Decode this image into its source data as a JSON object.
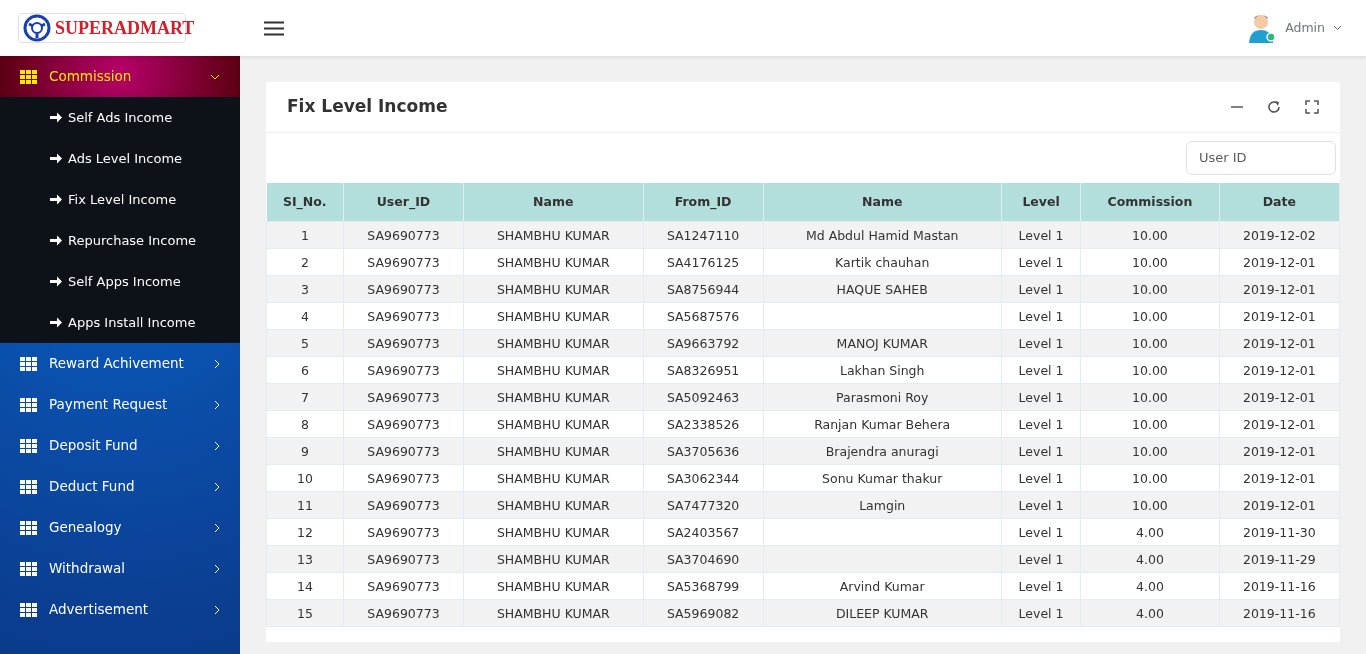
{
  "brand": {
    "name": "SUPERADMART"
  },
  "user": {
    "name": "Admin"
  },
  "sidebar": {
    "items": [
      {
        "label": "Commission",
        "expanded": true,
        "children": [
          {
            "label": "Self Ads Income"
          },
          {
            "label": "Ads Level Income"
          },
          {
            "label": "Fix Level Income"
          },
          {
            "label": "Repurchase Income"
          },
          {
            "label": "Self Apps Income"
          },
          {
            "label": "Apps Install Income"
          }
        ]
      },
      {
        "label": "Reward Achivement",
        "expanded": false
      },
      {
        "label": "Payment Request",
        "expanded": false
      },
      {
        "label": "Deposit Fund",
        "expanded": false
      },
      {
        "label": "Deduct Fund",
        "expanded": false
      },
      {
        "label": "Genealogy",
        "expanded": false
      },
      {
        "label": "Withdrawal",
        "expanded": false
      },
      {
        "label": "Advertisement",
        "expanded": false
      }
    ]
  },
  "panel": {
    "title": "Fix Level Income",
    "search": {
      "placeholder": "User ID"
    }
  },
  "table": {
    "columns": [
      "SI_No.",
      "User_ID",
      "Name",
      "From_ID",
      "Name",
      "Level",
      "Commission",
      "Date"
    ],
    "rows": [
      [
        "1",
        "SA9690773",
        "SHAMBHU KUMAR",
        "SA1247110",
        "Md Abdul Hamid Mastan",
        "Level 1",
        "10.00",
        "2019-12-02"
      ],
      [
        "2",
        "SA9690773",
        "SHAMBHU KUMAR",
        "SA4176125",
        "Kartik chauhan",
        "Level 1",
        "10.00",
        "2019-12-01"
      ],
      [
        "3",
        "SA9690773",
        "SHAMBHU KUMAR",
        "SA8756944",
        "HAQUE SAHEB",
        "Level 1",
        "10.00",
        "2019-12-01"
      ],
      [
        "4",
        "SA9690773",
        "SHAMBHU KUMAR",
        "SA5687576",
        "",
        "Level 1",
        "10.00",
        "2019-12-01"
      ],
      [
        "5",
        "SA9690773",
        "SHAMBHU KUMAR",
        "SA9663792",
        "MANOJ KUMAR",
        "Level 1",
        "10.00",
        "2019-12-01"
      ],
      [
        "6",
        "SA9690773",
        "SHAMBHU KUMAR",
        "SA8326951",
        "Lakhan Singh",
        "Level 1",
        "10.00",
        "2019-12-01"
      ],
      [
        "7",
        "SA9690773",
        "SHAMBHU KUMAR",
        "SA5092463",
        "Parasmoni Roy",
        "Level 1",
        "10.00",
        "2019-12-01"
      ],
      [
        "8",
        "SA9690773",
        "SHAMBHU KUMAR",
        "SA2338526",
        "Ranjan Kumar Behera",
        "Level 1",
        "10.00",
        "2019-12-01"
      ],
      [
        "9",
        "SA9690773",
        "SHAMBHU KUMAR",
        "SA3705636",
        "Brajendra anuragi",
        "Level 1",
        "10.00",
        "2019-12-01"
      ],
      [
        "10",
        "SA9690773",
        "SHAMBHU KUMAR",
        "SA3062344",
        "Sonu Kumar thakur",
        "Level 1",
        "10.00",
        "2019-12-01"
      ],
      [
        "11",
        "SA9690773",
        "SHAMBHU KUMAR",
        "SA7477320",
        "Lamgin",
        "Level 1",
        "10.00",
        "2019-12-01"
      ],
      [
        "12",
        "SA9690773",
        "SHAMBHU KUMAR",
        "SA2403567",
        "",
        "Level 1",
        "4.00",
        "2019-11-30"
      ],
      [
        "13",
        "SA9690773",
        "SHAMBHU KUMAR",
        "SA3704690",
        "",
        "Level 1",
        "4.00",
        "2019-11-29"
      ],
      [
        "14",
        "SA9690773",
        "SHAMBHU KUMAR",
        "SA5368799",
        "Arvind Kumar",
        "Level 1",
        "4.00",
        "2019-11-16"
      ],
      [
        "15",
        "SA9690773",
        "SHAMBHU KUMAR",
        "SA5969082",
        "DILEEP KUMAR",
        "Level 1",
        "4.00",
        "2019-11-16"
      ]
    ]
  }
}
